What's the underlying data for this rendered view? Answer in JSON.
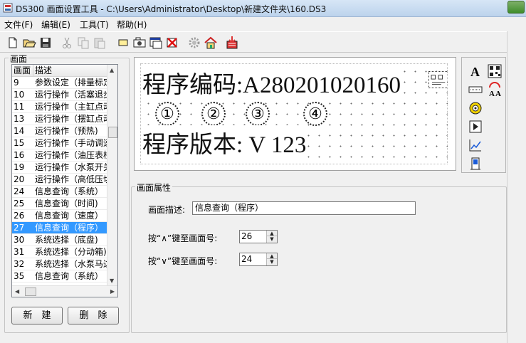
{
  "window": {
    "title": "DS300 画面设置工具 - C:\\Users\\Administrator\\Desktop\\新建文件夹\\160.DS3"
  },
  "menu": [
    "文件(F)",
    "编辑(E)",
    "工具(T)",
    "帮助(H)"
  ],
  "toolbar_icons": [
    "new-file-icon",
    "open-folder-icon",
    "save-icon",
    "cut-icon",
    "copy-icon",
    "paste-icon",
    "rectangle-icon",
    "camera-icon",
    "window-icon",
    "delete-icon",
    "gear-icon",
    "home-icon",
    "export-icon"
  ],
  "left_panel": {
    "group_title": "画面",
    "columns": [
      "画面",
      "描述"
    ],
    "rows": [
      {
        "id": "9",
        "desc": "参数设定（排量标定"
      },
      {
        "id": "10",
        "desc": "运行操作（活塞退步"
      },
      {
        "id": "11",
        "desc": "运行操作（主缸点动"
      },
      {
        "id": "13",
        "desc": "运行操作（摆缸点动"
      },
      {
        "id": "14",
        "desc": "运行操作（预热)"
      },
      {
        "id": "15",
        "desc": "运行操作（手动调速"
      },
      {
        "id": "16",
        "desc": "运行操作（油压表校"
      },
      {
        "id": "19",
        "desc": "运行操作（水泵开关"
      },
      {
        "id": "20",
        "desc": "运行操作（高低压切"
      },
      {
        "id": "24",
        "desc": "信息查询（系统）"
      },
      {
        "id": "25",
        "desc": "信息查询（时间)"
      },
      {
        "id": "26",
        "desc": "信息查询（速度）"
      },
      {
        "id": "27",
        "desc": "信息查询（程序）"
      },
      {
        "id": "30",
        "desc": "系统选择（底盘)"
      },
      {
        "id": "31",
        "desc": "系统选择（分动箱)"
      },
      {
        "id": "32",
        "desc": "系统选择（水泵马达"
      },
      {
        "id": "35",
        "desc": "信息查询（系统）"
      }
    ],
    "selected_id": "27",
    "new_button": "新　建",
    "delete_button": "删　除"
  },
  "preview": {
    "line1": "程序编码:A280201020160",
    "circles": [
      "①",
      "②",
      "③",
      "④"
    ],
    "line2": "程序版本: V 123"
  },
  "palette_icons": [
    "text-A-icon",
    "qr-icon",
    "number-field-icon",
    "rotate-A-icon",
    "indicator-lamp-icon",
    "play-icon",
    "trend-chart-icon",
    "switch-icon"
  ],
  "properties": {
    "group_title": "画面属性",
    "desc_label": "画面描述:",
    "desc_value": "信息查询（程序）",
    "up_label": "按“∧”键至画面号:",
    "up_value": "26",
    "down_label": "按“∨”键至画面号:",
    "down_value": "24"
  }
}
